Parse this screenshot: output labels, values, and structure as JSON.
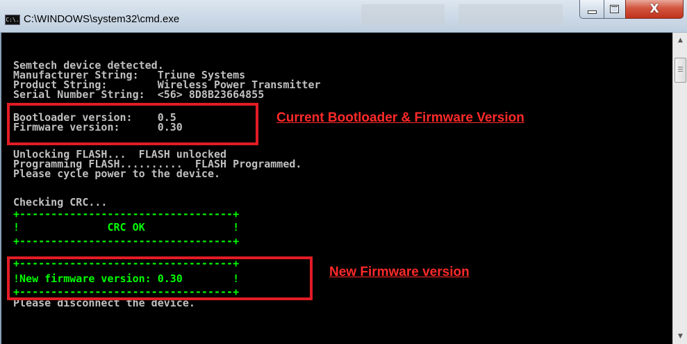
{
  "window": {
    "title": "C:\\WINDOWS\\system32\\cmd.exe",
    "app_icon_text": "C:\\.",
    "controls": {
      "close_glyph": "X"
    }
  },
  "console": {
    "lines": [
      "Semtech device detected.",
      "Manufacturer String:   Triune Systems",
      "Product String:        Wireless Power Transmitter",
      "Serial Number String:  <56> 8D8B23664855",
      "",
      "Bootloader version:    0.5",
      "Firmware version:      0.30",
      "",
      "Unlocking FLASH...  FLASH unlocked",
      "Programming FLASH..........  FLASH Programmed.",
      "Please cycle power to the device.",
      "",
      "Checking CRC...",
      "+----------------------------------+",
      "!              CRC OK              !",
      "+----------------------------------+",
      "",
      "+----------------------------------+",
      "!New firmware version: 0.30        !",
      "+----------------------------------+",
      "Please disconnect the device."
    ]
  },
  "annotations": {
    "current_version": "Current Bootloader & Firmware Version",
    "new_version": "New Firmware version"
  },
  "colors": {
    "console_bg": "#000000",
    "console_text": "#c0c0c0",
    "status_green": "#00ff00",
    "annotation_red": "#ff2a2a",
    "highlight_border": "#e21c25"
  }
}
